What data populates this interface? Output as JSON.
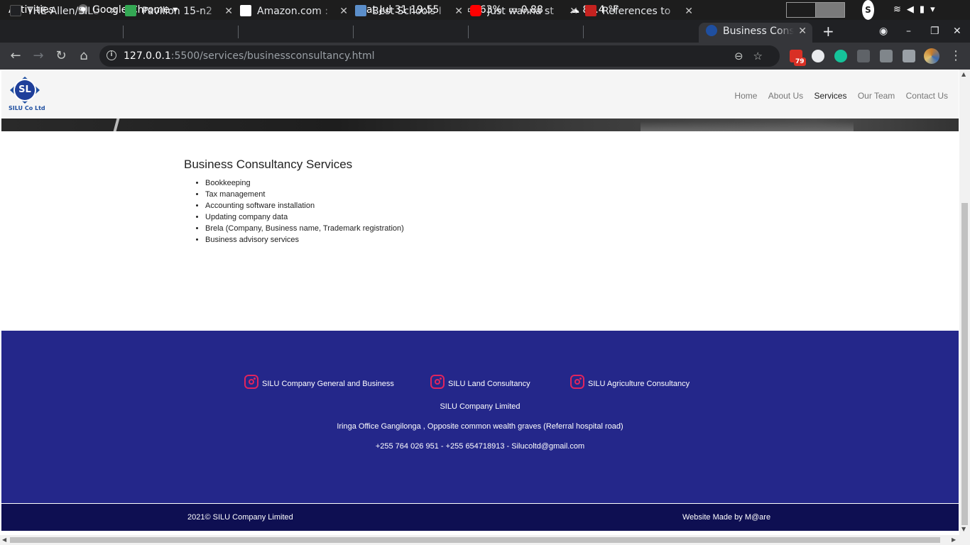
{
  "topbar": {
    "activities": "Activities",
    "app_menu": "Google Chrome ▾",
    "clock": "Sat Jul 31  19:55",
    "battery": "63%",
    "load": "0.88",
    "weather": "82.4 °F",
    "tray": "S"
  },
  "tabs": [
    {
      "title": "THE-Allen/SILU",
      "color": "#202124"
    },
    {
      "title": "Pavilion 15-n2",
      "color": "#34a853"
    },
    {
      "title": "Amazon.com :",
      "color": "#ffffff"
    },
    {
      "title": "Best Schools I",
      "color": "#5b8ec9"
    },
    {
      "title": "Just wanna st",
      "color": "#ff0000"
    },
    {
      "title": "References to",
      "color": "#c5221f"
    },
    {
      "title": "Business Cons",
      "color": "#1f4fa0"
    }
  ],
  "toolbar": {
    "url_host": "127.0.0.1",
    "url_path": ":5500/services/businessconsultancy.html",
    "ext_badge": "79"
  },
  "site": {
    "logo_text": "SL",
    "logo_caption": "SILU Co Ltd",
    "nav": [
      "Home",
      "About Us",
      "Services",
      "Our Team",
      "Contact Us"
    ],
    "active_nav": "Services"
  },
  "services": {
    "heading": "Business Consultancy Services",
    "items": [
      "Bookkeeping",
      "Tax management",
      "Accounting software installation",
      "Updating company data",
      "Brela (Company, Business name, Trademark registration)",
      "Business advisory services"
    ]
  },
  "footer": {
    "social": [
      "SILU Company General and Business",
      "SILU Land Consultancy",
      "SILU Agriculture Consultancy"
    ],
    "company": "SILU Company Limited",
    "address": "Iringa Office Gangilonga , Opposite common wealth graves (Referral hospital road)",
    "contact": "+255 764 026 951 - +255 654718913 - Silucoltd@gmail.com",
    "copyright": "2021© SILU Company Limited",
    "credit": "Website Made by M@are"
  },
  "colors": {
    "footer_bg": "#24278a",
    "bottom_bar_bg": "#0e0f52",
    "instagram": "#e0245e"
  }
}
